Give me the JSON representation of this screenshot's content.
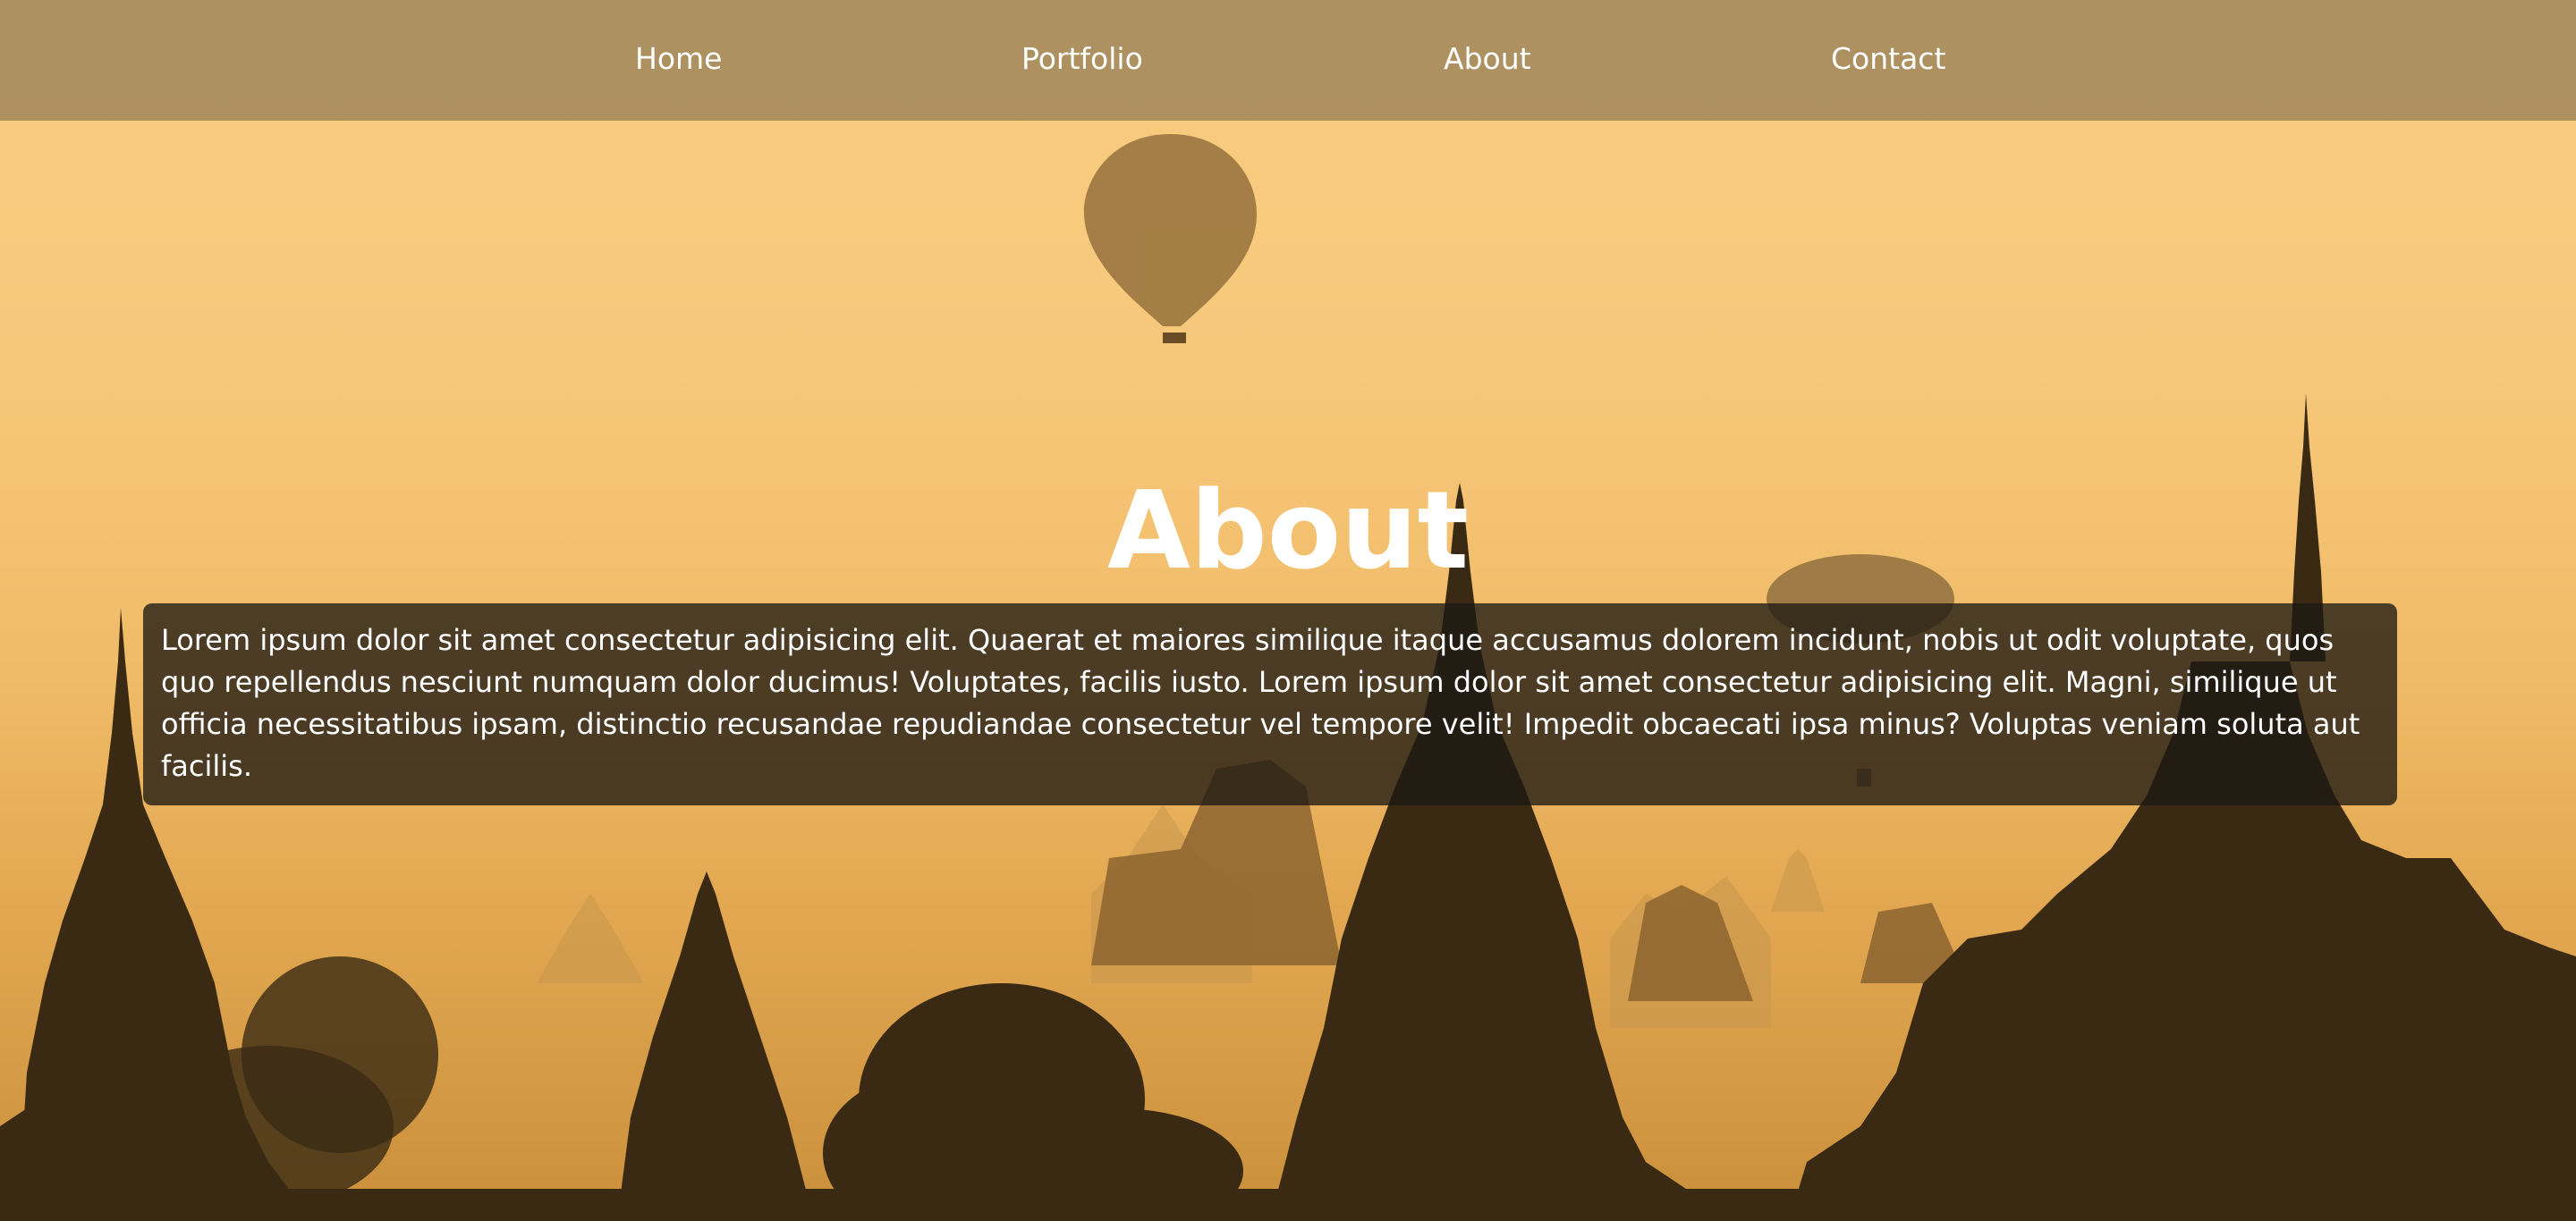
{
  "nav": {
    "items": [
      {
        "label": "Home"
      },
      {
        "label": "Portfolio"
      },
      {
        "label": "About"
      },
      {
        "label": "Contact"
      }
    ]
  },
  "hero": {
    "title": "About",
    "body": "Lorem ipsum dolor sit amet consectetur adipisicing elit. Quaerat et maiores similique itaque accusamus dolorem incidunt, nobis ut odit voluptate, quos quo repellendus nesciunt numquam dolor ducimus! Voluptates, facilis iusto. Lorem ipsum dolor sit amet consectetur adipisicing elit. Magni, similique ut officia necessitatibus ipsam, distinctio recusandae repudiandae consectetur vel tempore velit! Impedit obcaecati ipsa minus? Voluptas veniam soluta aut facilis."
  },
  "colors": {
    "sky": "#f8cc80",
    "navbar": "#967d55",
    "text_box": "#1e1812",
    "silhouette": "#3a2a14"
  },
  "background": {
    "icon": "hot-air-balloon-temples-sunset-photo"
  }
}
